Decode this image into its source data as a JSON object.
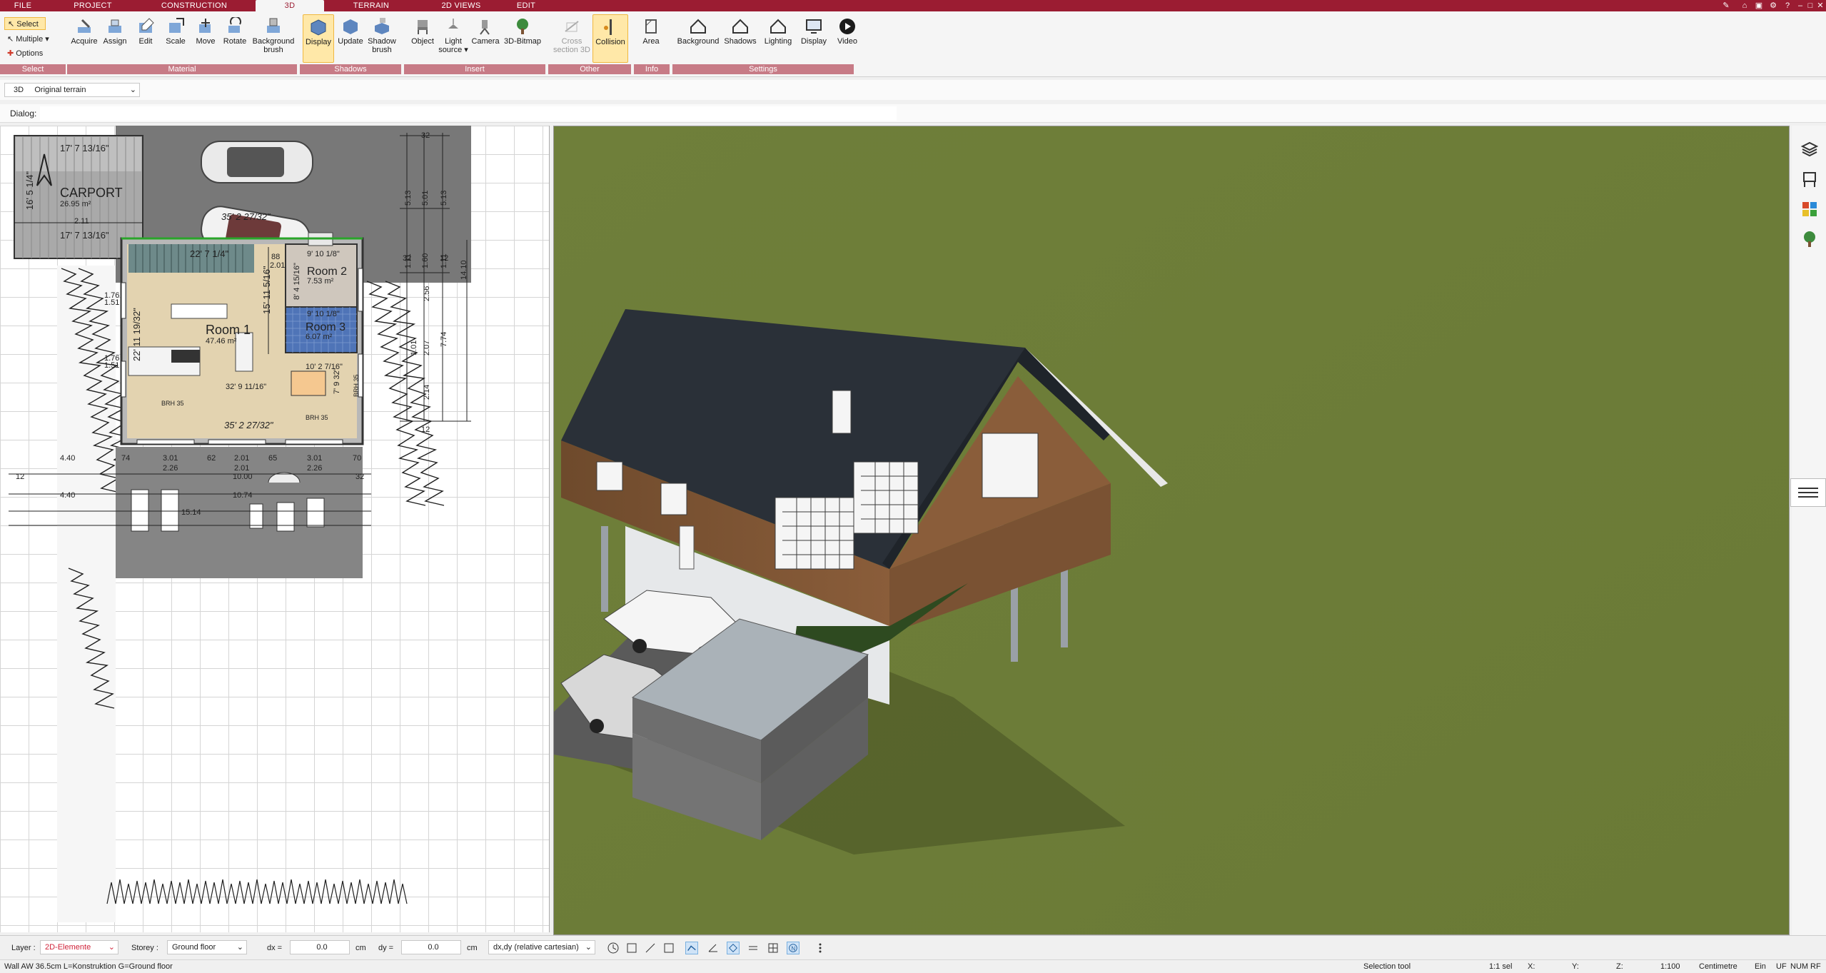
{
  "tabs": [
    "FILE",
    "PROJECT",
    "CONSTRUCTION",
    "3D",
    "TERRAIN",
    "2D VIEWS",
    "EDIT"
  ],
  "active_tab": "3D",
  "ribbon": {
    "select_group": {
      "select": "Select",
      "multiple": "Multiple",
      "options": "Options",
      "label": "Select"
    },
    "material_group": {
      "label": "Material",
      "acquire": "Acquire",
      "assign": "Assign",
      "edit": "Edit",
      "scale": "Scale",
      "move": "Move",
      "rotate": "Rotate",
      "background_brush_1": "Background",
      "background_brush_2": "brush"
    },
    "shadows_group": {
      "label": "Shadows",
      "display": "Display",
      "update": "Update",
      "shadow_brush_1": "Shadow",
      "shadow_brush_2": "brush"
    },
    "insert_group": {
      "label": "Insert",
      "object": "Object",
      "light_source_1": "Light",
      "light_source_2": "source",
      "camera": "Camera",
      "bitmap": "3D-Bitmap"
    },
    "other_group": {
      "label": "Other",
      "cross_section_1": "Cross",
      "cross_section_2": "section 3D",
      "collision": "Collision"
    },
    "info_group": {
      "label": "Info",
      "area": "Area"
    },
    "settings_group": {
      "label": "Settings",
      "background": "Background",
      "shadows": "Shadows",
      "lighting": "Lighting",
      "display": "Display",
      "video": "Video"
    }
  },
  "subbar": {
    "mode": "3D",
    "terrain_select": "Original terrain"
  },
  "dialog": {
    "label": "Dialog:"
  },
  "plan": {
    "carport_name": "CARPORT",
    "carport_area": "26.95 m²",
    "carport_width_top": "17' 7 13/16\"",
    "carport_width_bottom": "17' 7 13/16\"",
    "carport_depth": "16' 5 1/4\"",
    "driveway_width": "35' 2 27/32\"",
    "room1_name": "Room 1",
    "room1_area": "47.46 m²",
    "room2_name": "Room 2",
    "room2_area": "7.53 m²",
    "room3_name": "Room 3",
    "room3_area": "6.07 m²",
    "dim_stairs": "22' 7 1/4\"",
    "dim_inner": "15' 11 5/16\"",
    "dim_left": "22' 11 19/32\"",
    "dim_bottom": "32' 9 11/16\"",
    "dim_room3": "9' 10 1/8\"",
    "dim_room2": "9' 10 1/8\"",
    "dim_r2v": "8' 4 15/16\"",
    "dim_table": "10' 2 7/16\"",
    "dim_table_v": "7' 9 32\"",
    "dim_lower": "35' 2 27/32\"",
    "dim_8_8": "88",
    "dim_201": "2.01",
    "brh35_a": "BRH 35",
    "brh35_b": "BRH 35",
    "brh35_c": "BRH 35",
    "right_dims": [
      "5.13",
      "5.01",
      "5.13",
      "1.11",
      "1.60",
      "1.11",
      "14.10",
      "7.74",
      "2.56",
      "2.07",
      "2.14",
      "1.01"
    ],
    "lower_dims": [
      "4.40",
      "74",
      "3.01",
      "62",
      "2.01",
      "65",
      "3.01",
      "70",
      "2.26",
      "2.01",
      "2.26",
      "10.00",
      "10.74",
      "4.40",
      "12",
      "32",
      "15.14"
    ],
    "top_dims": [
      "32",
      "32",
      "12",
      "12"
    ],
    "left_dims": [
      "1.76",
      "1.51",
      "1.76",
      "1.51",
      "2.11"
    ]
  },
  "bottombar": {
    "layer_label": "Layer :",
    "layer_value": "2D-Elemente",
    "storey_label": "Storey :",
    "storey_value": "Ground floor",
    "dx_label": "dx =",
    "dx_value": "0.0",
    "dx_unit": "cm",
    "dy_label": "dy =",
    "dy_value": "0.0",
    "dy_unit": "cm",
    "coord_mode": "dx,dy (relative cartesian)"
  },
  "statusbar": {
    "left": "Wall AW 36.5cm L=Konstruktion G=Ground floor",
    "tool": "Selection tool",
    "sel": "1:1 sel",
    "x": "X:",
    "y": "Y:",
    "z": "Z:",
    "scale": "1:100",
    "unit": "Centimetre",
    "ein": "Ein",
    "uf": "UF",
    "num": "NUM",
    "rf": "RF"
  },
  "colors": {
    "tab_bar": "#9b1c32",
    "group_label": "#c77b86",
    "active_button": "#ffe8a8",
    "grass": "#6e7d3a",
    "roof": "#2a3038",
    "wood": "#7a5233"
  }
}
